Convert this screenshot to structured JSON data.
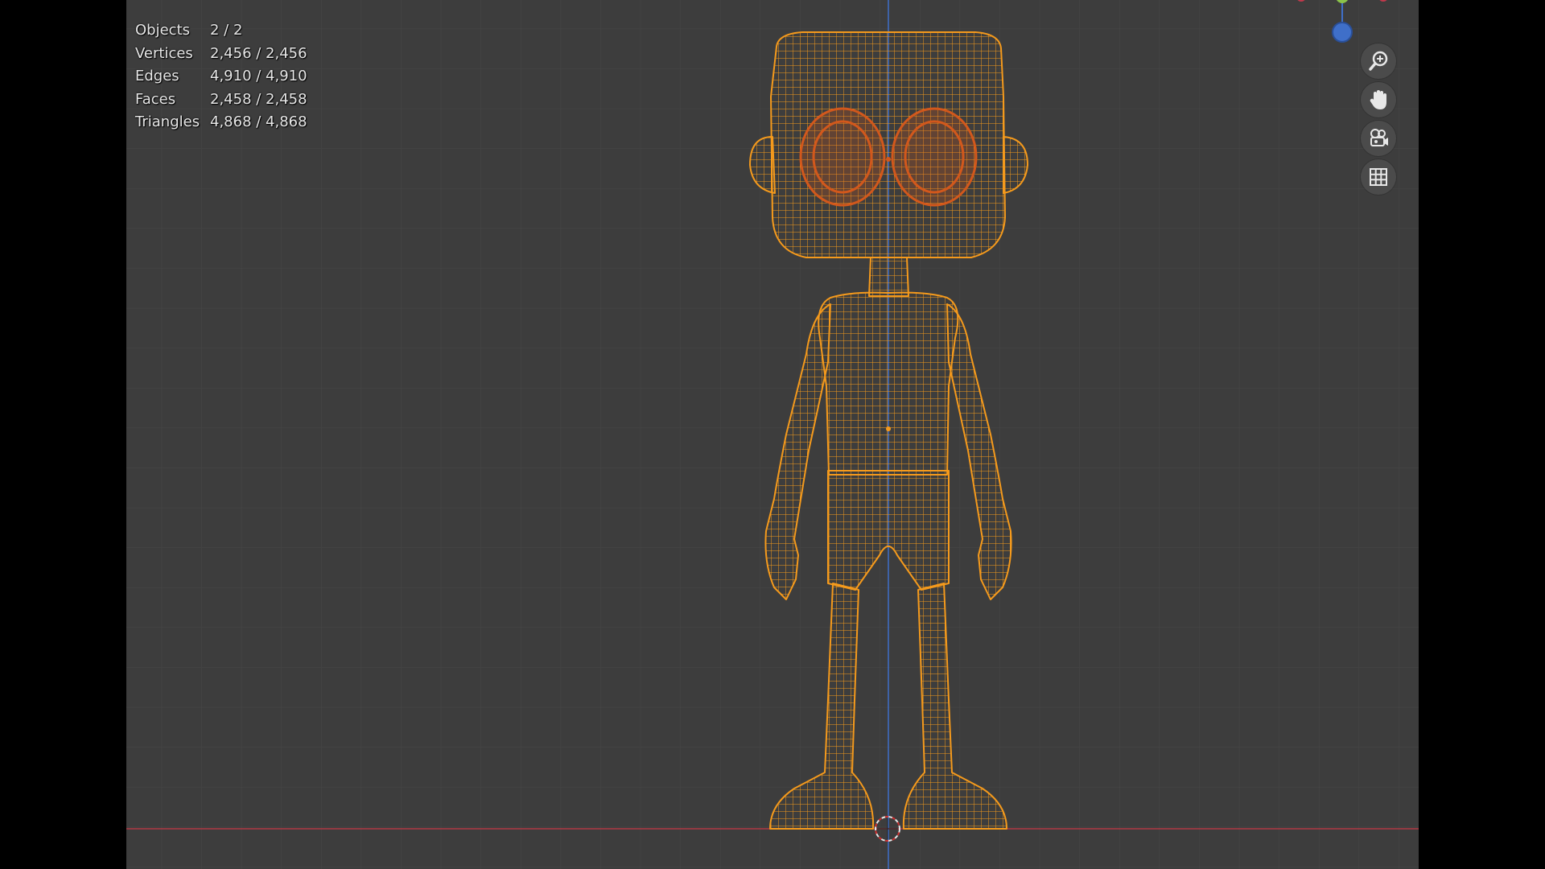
{
  "viewport": {
    "stats": [
      {
        "label": "Objects",
        "value": "2 / 2"
      },
      {
        "label": "Vertices",
        "value": "2,456 / 2,456"
      },
      {
        "label": "Edges",
        "value": "4,910 / 4,910"
      },
      {
        "label": "Faces",
        "value": "2,458 / 2,458"
      },
      {
        "label": "Triangles",
        "value": "4,868 / 4,868"
      }
    ],
    "nav_buttons": [
      {
        "name": "zoom-button",
        "icon": "zoom-in-icon"
      },
      {
        "name": "pan-button",
        "icon": "hand-icon"
      },
      {
        "name": "camera-view-button",
        "icon": "camera-icon"
      },
      {
        "name": "ortho-toggle-button",
        "icon": "grid-icon"
      }
    ],
    "colors": {
      "background": "#3d3d3d",
      "grid": "#4a4a4a",
      "x_axis": "#b03a45",
      "z_axis": "#3f6fc9",
      "wireframe": "#f59a1c",
      "eyes": "#d2581c"
    }
  }
}
